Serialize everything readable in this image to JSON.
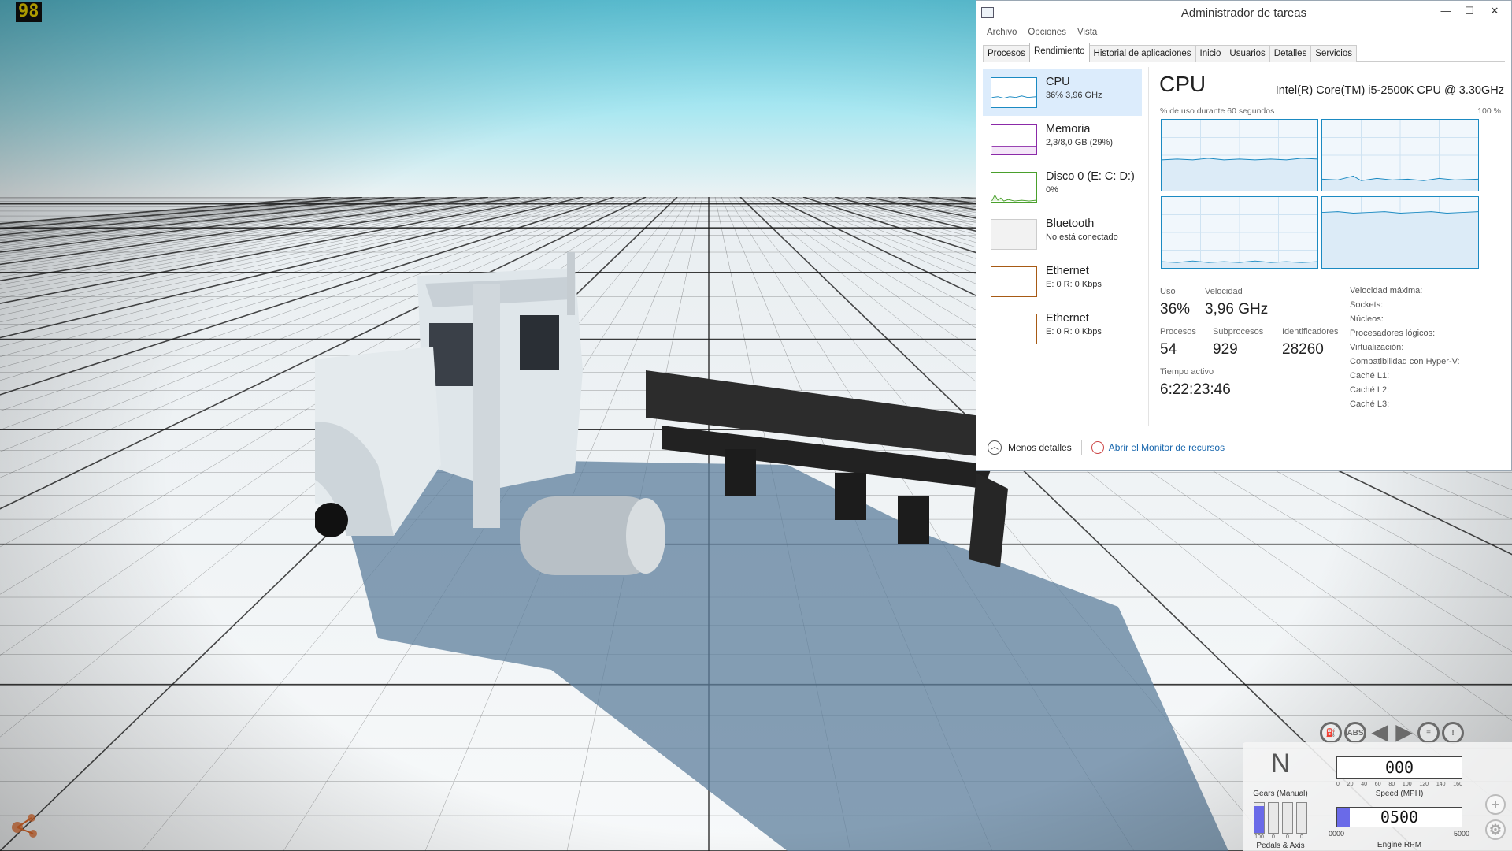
{
  "game": {
    "fps": "98",
    "hud": {
      "gear": "N",
      "gear_label": "Gears (Manual)",
      "pedals_label": "Pedals & Axis",
      "pedal_levels": [
        0.9,
        0.0,
        0.0,
        0.0
      ],
      "pedal_values": [
        "100",
        "0",
        "0",
        "0"
      ],
      "speed": "000",
      "speed_label": "Speed (MPH)",
      "speed_ticks": [
        "0",
        "20",
        "40",
        "60",
        "80",
        "100",
        "120",
        "140",
        "160"
      ],
      "rpm": "0500",
      "rpm_label": "Engine RPM",
      "rpm_min": "0000",
      "rpm_max": "5000",
      "rpm_level": 0.1,
      "icons": [
        "fuel-icon",
        "abs-icon",
        "left-turn-icon",
        "right-turn-icon",
        "headlight-icon",
        "warning-icon"
      ],
      "abs_text": "ABS",
      "side_buttons": [
        "zoom-in-icon",
        "settings-icon"
      ],
      "accent_color": "#6a6ae8"
    }
  },
  "task_manager": {
    "title": "Administrador de tareas",
    "menu": [
      "Archivo",
      "Opciones",
      "Vista"
    ],
    "tabs": [
      "Procesos",
      "Rendimiento",
      "Historial de aplicaciones",
      "Inicio",
      "Usuarios",
      "Detalles",
      "Servicios"
    ],
    "active_tab": "Rendimiento",
    "resources": [
      {
        "name": "CPU",
        "value": "36% 3,96 GHz",
        "color": "#1b8ac2"
      },
      {
        "name": "Memoria",
        "value": "2,3/8,0 GB (29%)",
        "color": "#8b2aa8"
      },
      {
        "name": "Disco 0 (E: C: D:)",
        "value": "0%",
        "color": "#4aa02c"
      },
      {
        "name": "Bluetooth",
        "value": "No está conectado",
        "color": "#bbbbbb"
      },
      {
        "name": "Ethernet",
        "value": "E: 0 R: 0 Kbps",
        "color": "#a75a14"
      },
      {
        "name": "Ethernet",
        "value": "E: 0 R: 0 Kbps",
        "color": "#a75a14"
      }
    ],
    "detail": {
      "title": "CPU",
      "model": "Intel(R) Core(TM) i5-2500K CPU @ 3.30GHz",
      "graph_caption": "% de uso durante 60 segundos",
      "graph_max": "100 %",
      "stats": {
        "uso_label": "Uso",
        "uso": "36%",
        "velocidad_label": "Velocidad",
        "velocidad": "3,96 GHz",
        "procesos_label": "Procesos",
        "procesos": "54",
        "subprocesos_label": "Subprocesos",
        "subprocesos": "929",
        "identificadores_label": "Identificadores",
        "identificadores": "28260",
        "tiempo_label": "Tiempo activo",
        "tiempo": "6:22:23:46"
      },
      "specs": [
        "Velocidad máxima:",
        "Sockets:",
        "Núcleos:",
        "Procesadores lógicos:",
        "Virtualización:",
        "Compatibilidad con Hyper-V:",
        "Caché L1:",
        "Caché L2:",
        "Caché L3:"
      ]
    },
    "footer": {
      "less_details": "Menos detalles",
      "open_monitor": "Abrir el Monitor de recursos"
    }
  }
}
